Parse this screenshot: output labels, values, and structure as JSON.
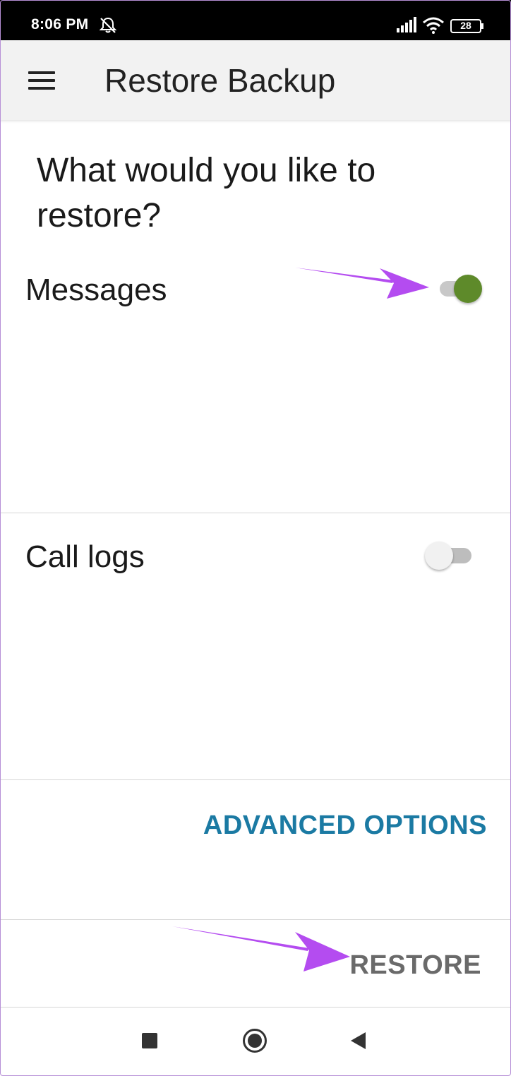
{
  "status_bar": {
    "time": "8:06 PM",
    "battery": "28",
    "icons": [
      "bell-off-icon",
      "signal-icon",
      "wifi-icon",
      "battery-icon"
    ]
  },
  "app_bar": {
    "title": "Restore Backup",
    "menu_icon": "hamburger-menu-icon"
  },
  "content": {
    "question": "What would you like to restore?",
    "options": [
      {
        "label": "Messages",
        "enabled": true
      },
      {
        "label": "Call logs",
        "enabled": false
      }
    ],
    "advanced_label": "ADVANCED OPTIONS",
    "restore_label": "RESTORE"
  },
  "nav_bar": {
    "buttons": [
      "recents-icon",
      "home-icon",
      "back-icon"
    ]
  },
  "colors": {
    "toggle_on": "#5e8a2a",
    "accent": "#1b7aa3",
    "annotation_arrow": "#b44cf0"
  }
}
